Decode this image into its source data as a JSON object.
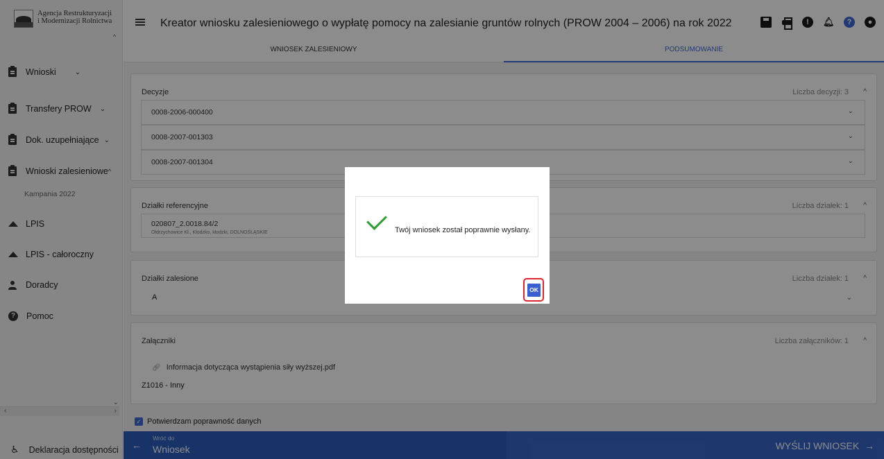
{
  "logo": {
    "line1": "Agencja Restrukturyzacji",
    "line2": "i Modernizacji Rolnictwa"
  },
  "sidebar": {
    "items": [
      {
        "label": "Wnioski",
        "chevron": "⌄"
      },
      {
        "label": "Transfery PROW",
        "chevron": "⌄"
      },
      {
        "label": "Dok. uzupełniające",
        "chevron": "⌄"
      },
      {
        "label": "Wnioski zalesieniowe",
        "chevron": "^"
      },
      {
        "label": "LPIS"
      },
      {
        "label": "LPIS - całoroczny"
      },
      {
        "label": "Doradcy"
      },
      {
        "label": "Pomoc"
      }
    ],
    "sub_item": "Kampania 2022",
    "accessibility": "Deklaracja dostępności"
  },
  "header": {
    "title": "Kreator wniosku zalesieniowego o wypłatę pomocy na zalesianie gruntów rolnych (PROW 2004 – 2006) na rok 2022"
  },
  "tabs": [
    {
      "label": "WNIOSEK ZALESIENIOWY"
    },
    {
      "label": "PODSUMOWANIE",
      "active": true
    }
  ],
  "sections": {
    "decyzje": {
      "title": "Decyzje",
      "count": "Liczba decyzji: 3",
      "rows": [
        "0008-2006-000400",
        "0008-2007-001303",
        "0008-2007-001304"
      ]
    },
    "dzialki_ref": {
      "title": "Działki referencyjne",
      "count": "Liczba działek: 1",
      "item_id": "020807_2.0018.84/2",
      "item_detail": "Ołdrzychowice Kł., Kłodzko, kłodzki, DOLNOŚLĄSKIE"
    },
    "dzialki_zal": {
      "title": "Działki zalesione",
      "count": "Liczba działek: 1",
      "item": "A"
    },
    "zalaczniki": {
      "title": "Załączniki",
      "count": "Liczba załączników: 1",
      "file": "Informacja dotycząca wystąpienia siły wyższej.pdf",
      "type": "Z1016 - Inny"
    }
  },
  "confirm_label": "Potwierdzam poprawność danych",
  "footer": {
    "back_sub": "Wróć do",
    "back_main": "Wniosek",
    "send": "WYŚLIJ WNIOSEK"
  },
  "modal": {
    "message": "Twój wniosek został poprawnie wysłany.",
    "ok": "OK"
  },
  "colors": {
    "accent": "#3c6bd6",
    "footer": "#2d5dbd",
    "success": "#2e9e32",
    "highlight": "#e4232a"
  }
}
